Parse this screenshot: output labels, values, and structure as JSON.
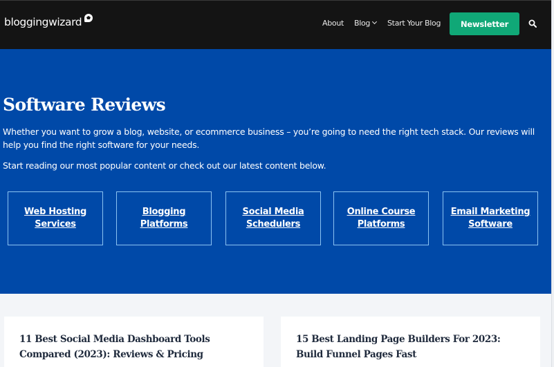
{
  "header": {
    "logo_text": "bloggingwizard",
    "nav": {
      "about": "About",
      "blog": "Blog",
      "start_blog": "Start Your Blog"
    },
    "newsletter_label": "Newsletter",
    "search_icon": "search-icon"
  },
  "hero": {
    "title": "Software Reviews",
    "paragraph1": "Whether you want to grow a blog, website, or ecommerce business – you’re going to need the right tech stack. Our reviews will help you find the right software for your needs.",
    "paragraph2": "Start reading our most popular content or check out our latest content below.",
    "categories": [
      {
        "line1": "Web Hosting",
        "line2": "Services"
      },
      {
        "line1": "Blogging",
        "line2": "Platforms"
      },
      {
        "line1": "Social Media",
        "line2": "Schedulers"
      },
      {
        "line1": "Online Course",
        "line2": "Platforms"
      },
      {
        "line1": "Email Marketing",
        "line2": "Software"
      }
    ]
  },
  "articles": [
    {
      "title": "11 Best Social Media Dashboard Tools Compared (2023): Reviews & Pricing"
    },
    {
      "title": "15 Best Landing Page Builders For 2023: Build Funnel Pages Fast"
    }
  ],
  "colors": {
    "header_bg": "#141414",
    "hero_bg": "#0049a8",
    "accent_green": "#10a877",
    "box_border": "#8cc3f2"
  }
}
